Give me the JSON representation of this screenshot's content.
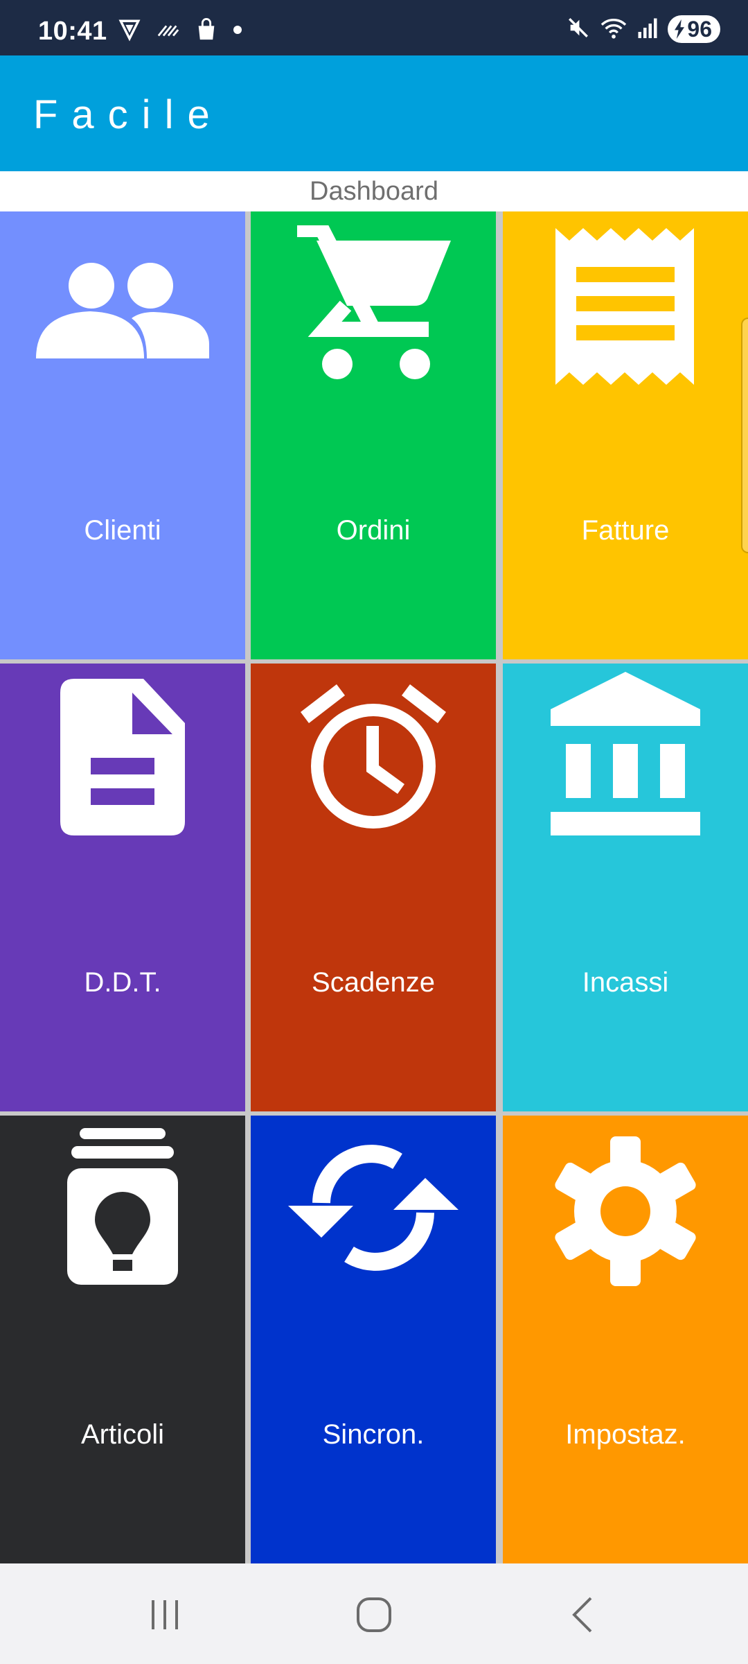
{
  "status_bar": {
    "time": "10:41",
    "battery": "96",
    "icons": [
      "vpn-icon",
      "signal-wave-icon",
      "shopping-bag-icon",
      "notification-dot",
      "mute-icon",
      "wifi-icon",
      "cellular-signal-icon",
      "charging-bolt-icon"
    ]
  },
  "app": {
    "title": "Facile"
  },
  "dashboard": {
    "header": "Dashboard",
    "tiles": [
      {
        "label": "Clienti",
        "icon": "people-icon",
        "color": "#738ffe"
      },
      {
        "label": "Ordini",
        "icon": "shopping-cart-icon",
        "color": "#00c853"
      },
      {
        "label": "Fatture",
        "icon": "receipt-icon",
        "color": "#ffc400"
      },
      {
        "label": "D.D.T.",
        "icon": "document-icon",
        "color": "#673ab7"
      },
      {
        "label": "Scadenze",
        "icon": "alarm-clock-icon",
        "color": "#bf360c"
      },
      {
        "label": "Incassi",
        "icon": "bank-icon",
        "color": "#26c6da"
      },
      {
        "label": "Articoli",
        "icon": "product-box-icon",
        "color": "#2a2b2d"
      },
      {
        "label": "Sincron.",
        "icon": "sync-icon",
        "color": "#0033cc"
      },
      {
        "label": "Impostaz.",
        "icon": "settings-gear-icon",
        "color": "#ff9800"
      }
    ]
  },
  "nav_bar": {
    "buttons": [
      "recent-apps-icon",
      "home-icon",
      "back-icon"
    ]
  }
}
